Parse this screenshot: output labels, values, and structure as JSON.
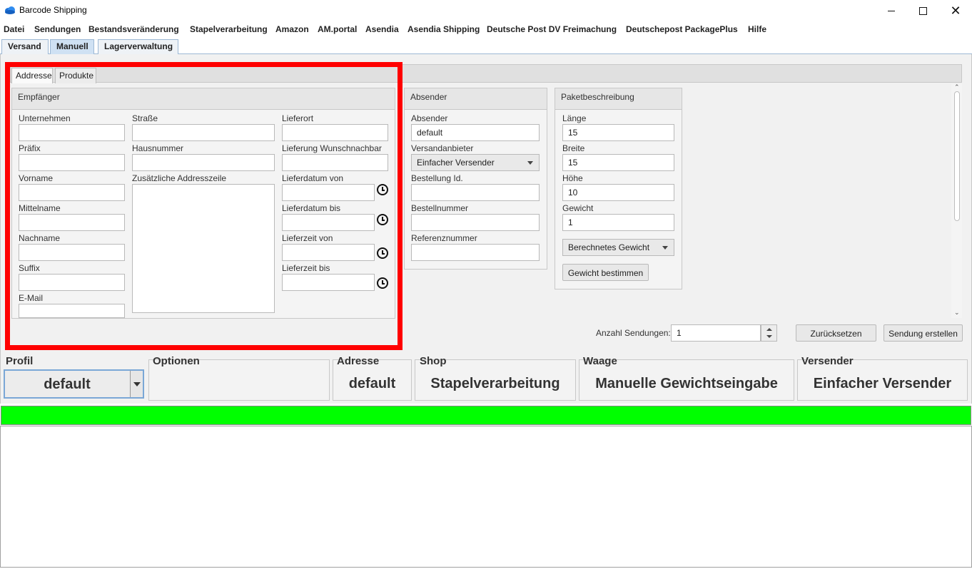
{
  "window": {
    "title": "Barcode Shipping"
  },
  "menu": [
    "Datei",
    "Sendungen",
    "Bestandsveränderung",
    "Stapelverarbeitung",
    "Amazon",
    "AM.portal",
    "Asendia",
    "Asendia Shipping",
    "Deutsche Post DV Freimachung",
    "Deutschepost PackagePlus",
    "Hilfe"
  ],
  "main_tabs": [
    "Versand",
    "Manuell",
    "Lagerverwaltung"
  ],
  "sub_tabs": [
    "Addresse",
    "Produkte"
  ],
  "empfaenger": {
    "title": "Empfänger",
    "col1": [
      "Unternehmen",
      "Präfix",
      "Vorname",
      "Mittelname",
      "Nachname",
      "Suffix",
      "E-Mail"
    ],
    "col2": {
      "strasse": "Straße",
      "hausnummer": "Hausnummer",
      "zusatz": "Zusätzliche Addresszeile"
    },
    "col3": [
      "Lieferort",
      "Lieferung Wunschnachbar",
      "Lieferdatum von",
      "Lieferdatum bis",
      "Lieferzeit von",
      "Lieferzeit bis"
    ]
  },
  "absender": {
    "title": "Absender",
    "absender_label": "Absender",
    "absender_value": "default",
    "versandanbieter_label": "Versandanbieter",
    "versandanbieter_value": "Einfacher Versender",
    "bestellung_id_label": "Bestellung Id.",
    "bestellnummer_label": "Bestellnummer",
    "referenznummer_label": "Referenznummer"
  },
  "paket": {
    "title": "Paketbeschreibung",
    "laenge_label": "Länge",
    "laenge_value": "15",
    "breite_label": "Breite",
    "breite_value": "15",
    "hoehe_label": "Höhe",
    "hoehe_value": "10",
    "gewicht_label": "Gewicht",
    "gewicht_value": "1",
    "gewicht_mode": "Berechnetes Gewicht",
    "gewicht_button": "Gewicht bestimmen"
  },
  "footer": {
    "anzahl_label": "Anzahl Sendungen:",
    "anzahl_value": "1",
    "reset_button": "Zurücksetzen",
    "create_button": "Sendung erstellen"
  },
  "status": {
    "profil_title": "Profil",
    "profil_value": "default",
    "optionen_title": "Optionen",
    "adresse_title": "Adresse",
    "adresse_value": "default",
    "shop_title": "Shop",
    "shop_value": "Stapelverarbeitung",
    "waage_title": "Waage",
    "waage_value": "Manuelle Gewichtseingabe",
    "versender_title": "Versender",
    "versender_value": "Einfacher Versender"
  },
  "colors": {
    "highlight_frame": "#ff0000",
    "status_bar": "#00ff00",
    "active_tab": "#cfe1f3"
  },
  "icons": {
    "app": "cloud-icon",
    "time_picker": "clock-icon"
  }
}
